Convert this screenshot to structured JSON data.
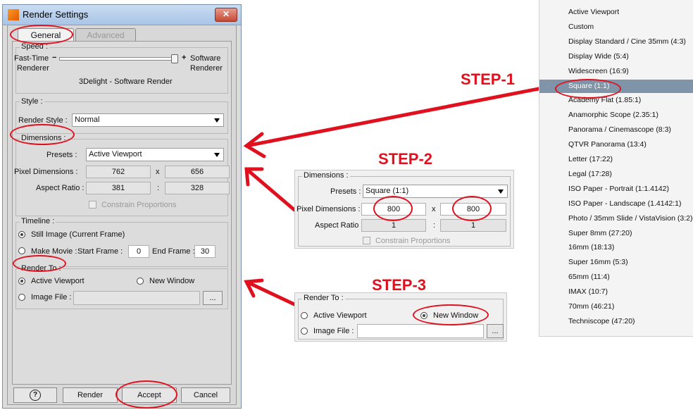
{
  "dialog": {
    "title": "Render Settings",
    "close_icon": "close-icon",
    "tabs": [
      "General",
      "Advanced"
    ],
    "speed": {
      "group_title": "Speed :",
      "left_label": "Fast-Time",
      "left_sub": "Renderer",
      "minus": "−",
      "plus": "+",
      "right_label": "Software",
      "right_sub": "Renderer",
      "slider_fraction": 1.0,
      "caption": "3Delight - Software Render"
    },
    "style": {
      "group_title": "Style :",
      "label": "Render Style :",
      "value": "Normal"
    },
    "dimensions": {
      "group_title": "Dimensions :",
      "presets_label": "Presets :",
      "presets_value": "Active Viewport",
      "pixel_label": "Pixel Dimensions :",
      "pixel_w": "762",
      "pixel_x": "x",
      "pixel_h": "656",
      "aspect_label": "Aspect Ratio :",
      "aspect_w": "381",
      "aspect_sep": ":",
      "aspect_h": "328",
      "constrain_label": "Constrain Proportions"
    },
    "timeline": {
      "group_title": "Timeline :",
      "still_label": "Still Image (Current Frame)",
      "movie_label": "Make Movie :",
      "start_label": "Start Frame :",
      "start_value": "0",
      "end_label": "End Frame :",
      "end_value": "30"
    },
    "render_to": {
      "group_title": "Render To :",
      "viewport_label": "Active Viewport",
      "window_label": "New Window",
      "file_label": "Image File :",
      "browse_label": "..."
    },
    "footer": {
      "help_label": "?",
      "render_label": "Render",
      "accept_label": "Accept",
      "cancel_label": "Cancel"
    }
  },
  "steps": {
    "step1": "STEP-1",
    "step2": "STEP-2",
    "step3": "STEP-3"
  },
  "step2_panel": {
    "group_title": "Dimensions :",
    "presets_label": "Presets :",
    "presets_value": "Square (1:1)",
    "pixel_label": "Pixel Dimensions :",
    "pixel_w": "800",
    "pixel_x": "x",
    "pixel_h": "800",
    "aspect_label": "Aspect Ratio :",
    "aspect_w": "1",
    "aspect_sep": ":",
    "aspect_h": "1",
    "constrain_label": "Constrain Proportions"
  },
  "step3_panel": {
    "group_title": "Render To :",
    "viewport_label": "Active Viewport",
    "window_label": "New Window",
    "file_label": "Image File :",
    "browse_label": "..."
  },
  "preset_list": {
    "check_mark": "✓",
    "selected_index": 5,
    "items": [
      "Active Viewport",
      "Custom",
      "Display Standard / Cine 35mm (4:3)",
      "Display Wide (5:4)",
      "Widescreen (16:9)",
      "Square (1:1)",
      "Academy Flat (1.85:1)",
      "Anamorphic Scope (2.35:1)",
      "Panorama / Cinemascope (8:3)",
      "QTVR Panorama (13:4)",
      "Letter (17:22)",
      "Legal (17:28)",
      "ISO Paper - Portrait (1:1.4142)",
      "ISO Paper - Landscape (1.4142:1)",
      "Photo / 35mm Slide / VistaVision (3:2)",
      "Super 8mm (27:20)",
      "16mm (18:13)",
      "Super 16mm (5:3)",
      "65mm (11:4)",
      "IMAX (10:7)",
      "70mm (46:21)",
      "Techniscope (47:20)"
    ]
  }
}
